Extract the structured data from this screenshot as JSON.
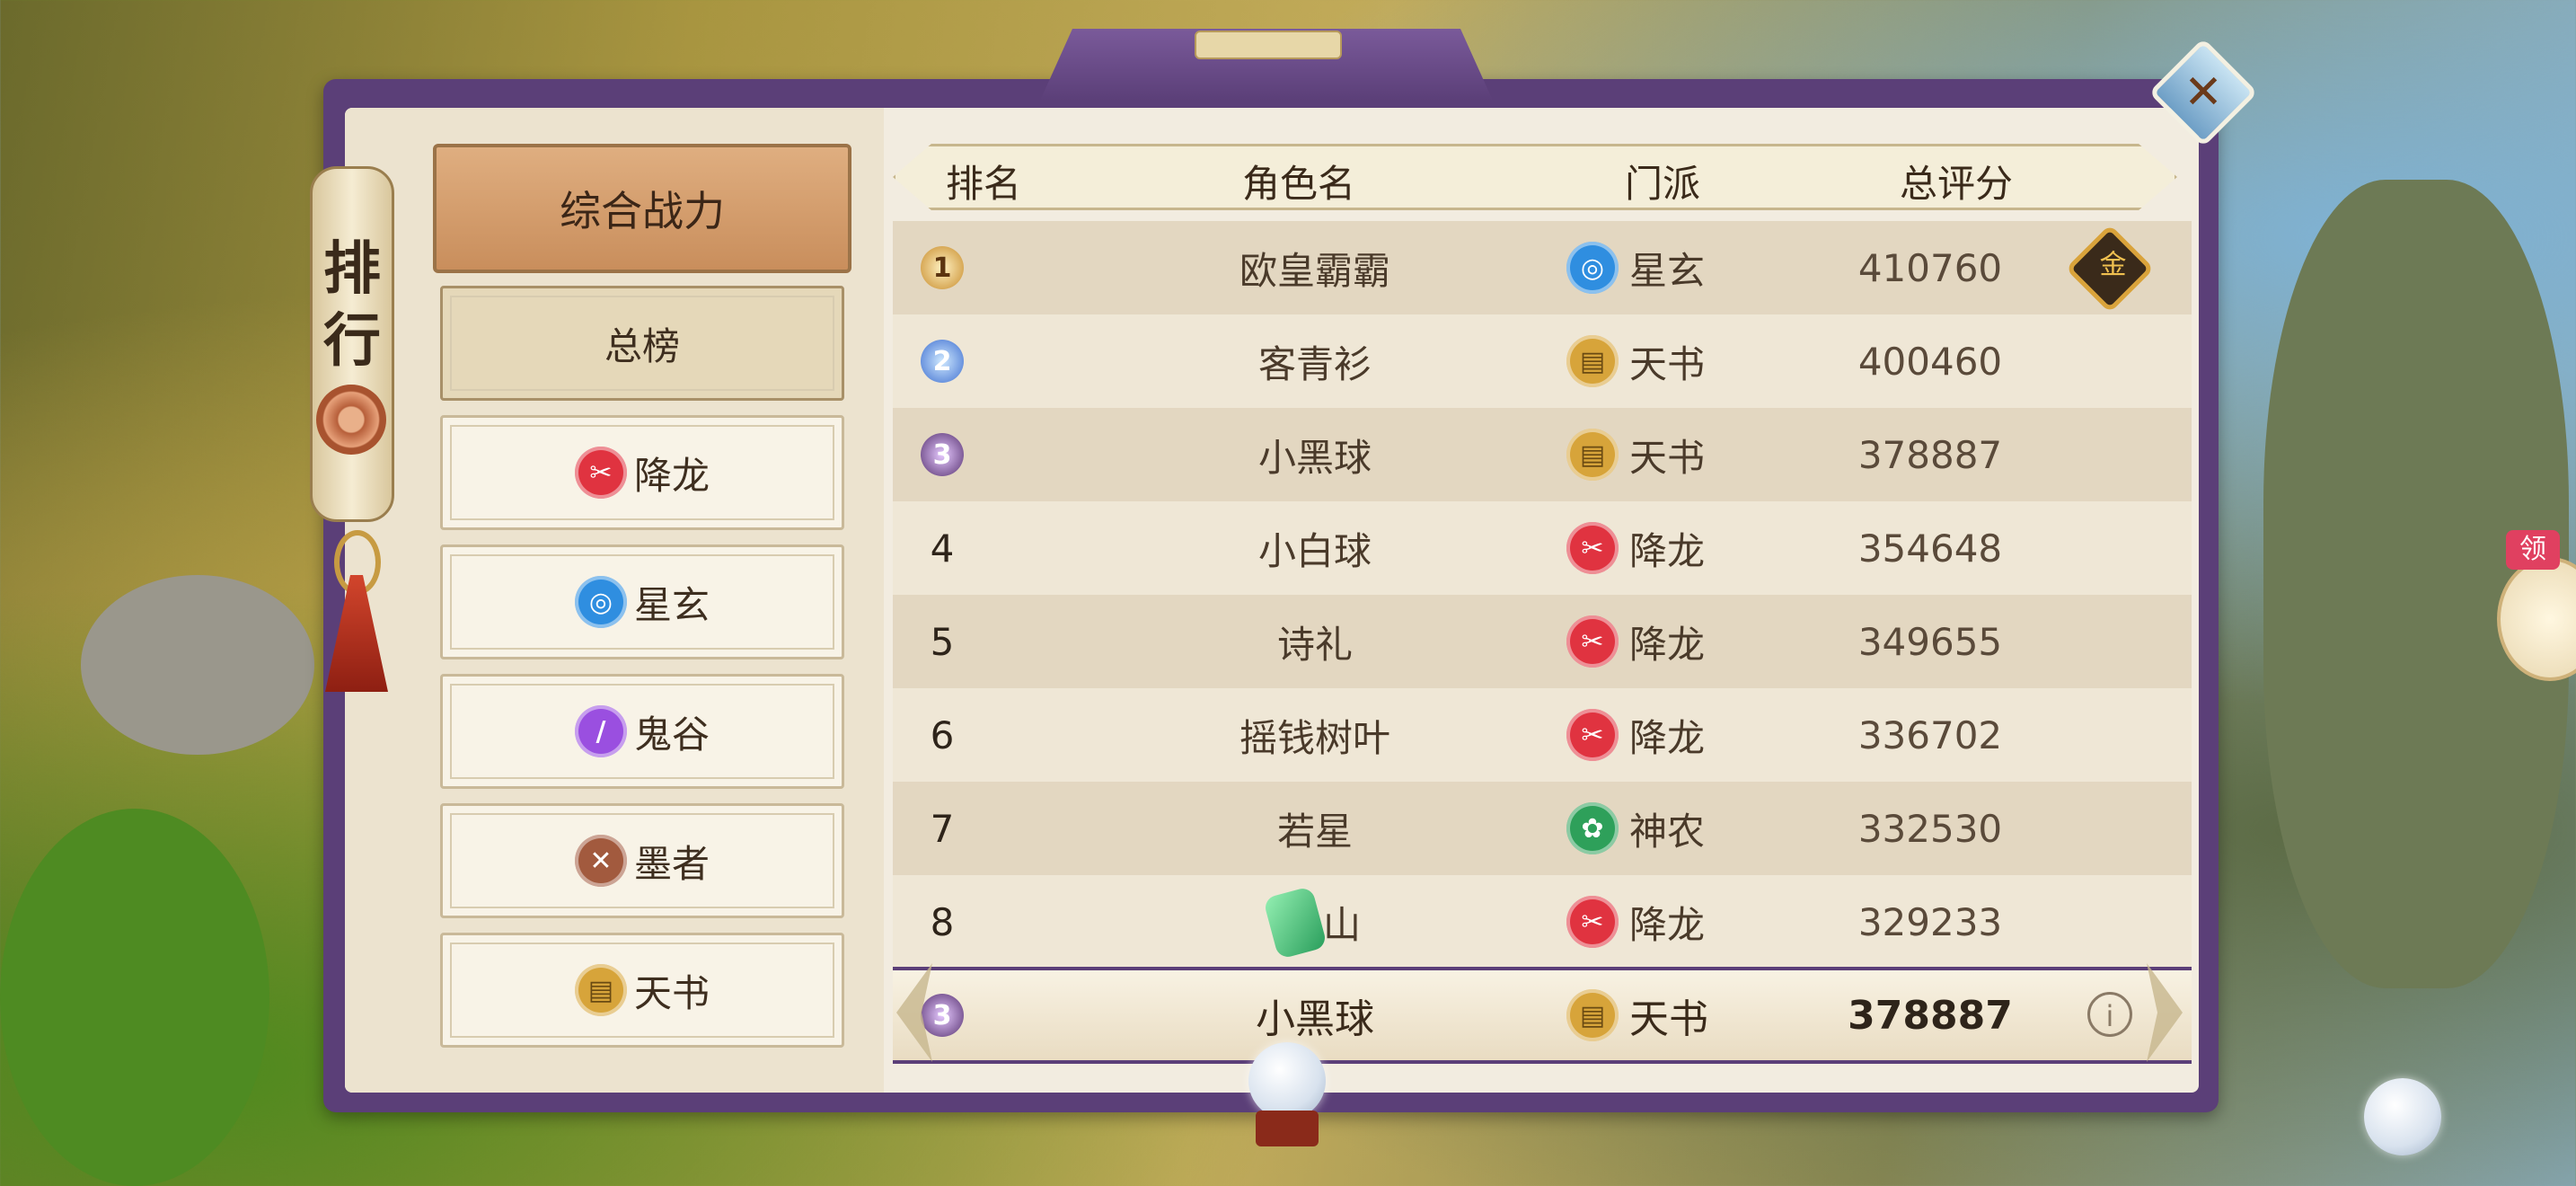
{
  "scroll": {
    "char1": "排",
    "char2": "行"
  },
  "category": {
    "title": "综合战力"
  },
  "menu": [
    {
      "label": "总榜",
      "icon": "",
      "active": true
    },
    {
      "label": "降龙",
      "icon": "jianglong-icon"
    },
    {
      "label": "星玄",
      "icon": "xingxuan-icon"
    },
    {
      "label": "鬼谷",
      "icon": "guigu-icon"
    },
    {
      "label": "墨者",
      "icon": "mozhe-icon"
    },
    {
      "label": "天书",
      "icon": "tianshu-icon"
    }
  ],
  "table": {
    "headers": {
      "rank": "排名",
      "name": "角色名",
      "sect": "门派",
      "score": "总评分"
    },
    "rows": [
      {
        "rank": "1",
        "name": "欧皇霸霸",
        "sect": "星玄",
        "score": "410760",
        "medal": "金"
      },
      {
        "rank": "2",
        "name": "客青衫",
        "sect": "天书",
        "score": "400460"
      },
      {
        "rank": "3",
        "name": "小黑球",
        "sect": "天书",
        "score": "378887"
      },
      {
        "rank": "4",
        "name": "小白球",
        "sect": "降龙",
        "score": "354648"
      },
      {
        "rank": "5",
        "name": "诗礼",
        "sect": "降龙",
        "score": "349655"
      },
      {
        "rank": "6",
        "name": "摇钱树叶",
        "sect": "降龙",
        "score": "336702"
      },
      {
        "rank": "7",
        "name": "若星",
        "sect": "神农",
        "score": "332530"
      },
      {
        "rank": "8",
        "name": "山",
        "sect": "降龙",
        "score": "329233"
      }
    ]
  },
  "self": {
    "rank": "3",
    "name": "小黑球",
    "sect": "天书",
    "score": "378887"
  },
  "side": {
    "tab": "领"
  },
  "colors": {
    "frame": "#5b3f78",
    "panel": "#f2ece0",
    "accent": "#c98e5c"
  }
}
